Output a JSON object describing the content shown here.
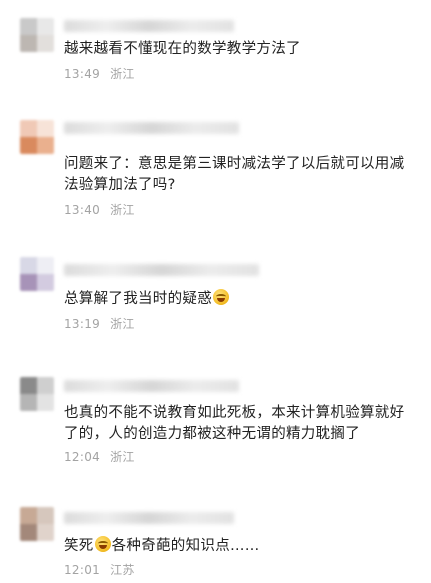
{
  "comments": [
    {
      "text": "越来越看不懂现在的数学教学方法了",
      "time": "13:49",
      "location": "浙江",
      "avatar_colors": [
        "#c9c9c9",
        "#e8e8e8",
        "#bdb7b2",
        "#e2dfdc"
      ]
    },
    {
      "text": "问题来了：意思是第三课时减法学了以后就可以用减法验算加法了吗?",
      "time": "13:40",
      "location": "浙江",
      "avatar_colors": [
        "#f0c9b6",
        "#f7e3d8",
        "#d98a5e",
        "#eab08e"
      ]
    },
    {
      "text": "总算解了我当时的疑惑",
      "emoji": "laughing-crying-emoji",
      "time": "13:19",
      "location": "浙江",
      "avatar_colors": [
        "#d8d8e6",
        "#eeeef4",
        "#a793b8",
        "#d3cbe0"
      ]
    },
    {
      "text": "也真的不能不说教育如此死板，本来计算机验算就好了的，人的创造力都被这种无谓的精力耽搁了",
      "time": "12:04",
      "location": "浙江",
      "avatar_colors": [
        "#8a8a8a",
        "#cfcfcf",
        "#b5b5b5",
        "#e3e3e3"
      ]
    },
    {
      "text_before": "笑死",
      "emoji": "laughing-emoji",
      "text_after": "各种奇葩的知识点……",
      "time": "12:01",
      "location": "江苏",
      "avatar_colors": [
        "#c7a995",
        "#d6c7bd",
        "#a3887a",
        "#e0d3cb"
      ]
    }
  ]
}
